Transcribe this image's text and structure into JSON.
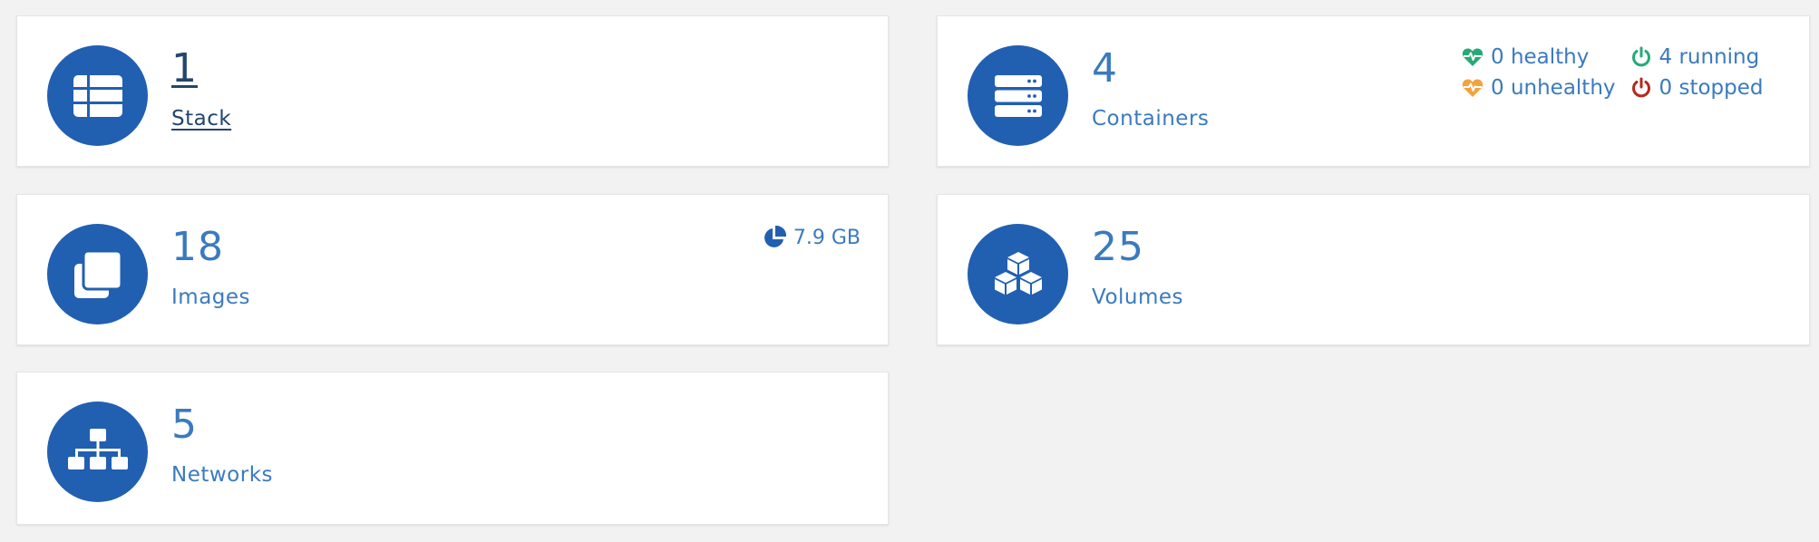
{
  "colors": {
    "background": "#f2f2f2",
    "card": "#ffffff",
    "accent_circle": "#215fb1",
    "text": "#3a7abf",
    "link": "#23456e",
    "healthy": "#27a97a",
    "unhealthy": "#f0a340",
    "running": "#27a97a",
    "stopped": "#b5291f"
  },
  "stack": {
    "count": "1",
    "label": "Stack",
    "icon": "list-table-icon"
  },
  "containers": {
    "count": "4",
    "label": "Containers",
    "icon": "server-icon",
    "status": {
      "healthy": "0 healthy",
      "running": "4 running",
      "unhealthy": "0 unhealthy",
      "stopped": "0 stopped"
    }
  },
  "images": {
    "count": "18",
    "label": "Images",
    "size": "7.9 GB",
    "icon": "clone-icon"
  },
  "volumes": {
    "count": "25",
    "label": "Volumes",
    "icon": "cubes-icon"
  },
  "networks": {
    "count": "5",
    "label": "Networks",
    "icon": "sitemap-icon"
  }
}
